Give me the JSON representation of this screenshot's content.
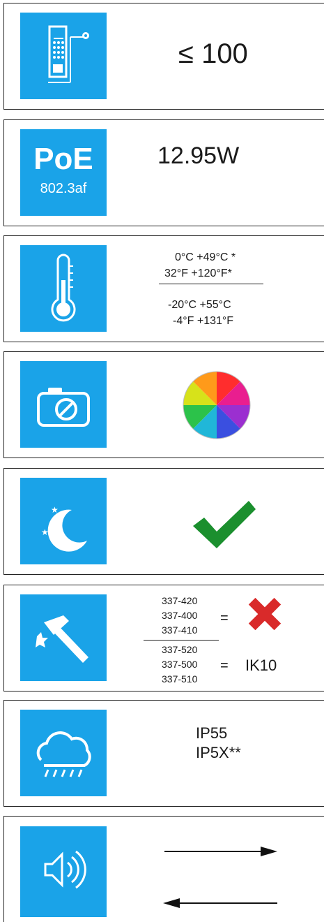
{
  "rows": [
    {
      "id": "capacity",
      "icon": "door-station-icon",
      "value": "≤ 100"
    },
    {
      "id": "power",
      "icon": "poe-icon",
      "poe_title": "PoE",
      "poe_standard": "802.3af",
      "value": "12.95W"
    },
    {
      "id": "temperature",
      "icon": "thermometer-icon",
      "operating_c": "0°C  +49°C *",
      "operating_f": "32°F   +120°F*",
      "storage_c": "-20°C  +55°C",
      "storage_f": "-4°F   +131°F"
    },
    {
      "id": "camera",
      "icon": "camera-icon",
      "value_icon": "color-wheel-icon"
    },
    {
      "id": "night-vision",
      "icon": "moon-stars-icon",
      "value_icon": "check-icon"
    },
    {
      "id": "vandal",
      "icon": "hammer-icon",
      "group_a": [
        "337-420",
        "337-400",
        "337-410"
      ],
      "group_a_eq": "=",
      "group_a_result_icon": "cross-icon",
      "group_b": [
        "337-520",
        "337-500",
        "337-510"
      ],
      "group_b_eq": "=",
      "group_b_result": "IK10"
    },
    {
      "id": "weather",
      "icon": "rain-cloud-icon",
      "line1": "IP55",
      "line2": "IP5X**"
    },
    {
      "id": "audio",
      "icon": "speaker-icon",
      "value_icon": "two-way-arrows-icon"
    }
  ],
  "colors": {
    "tile": "#1aa3e8",
    "check": "#1b8f2e",
    "cross": "#d92a2a"
  }
}
